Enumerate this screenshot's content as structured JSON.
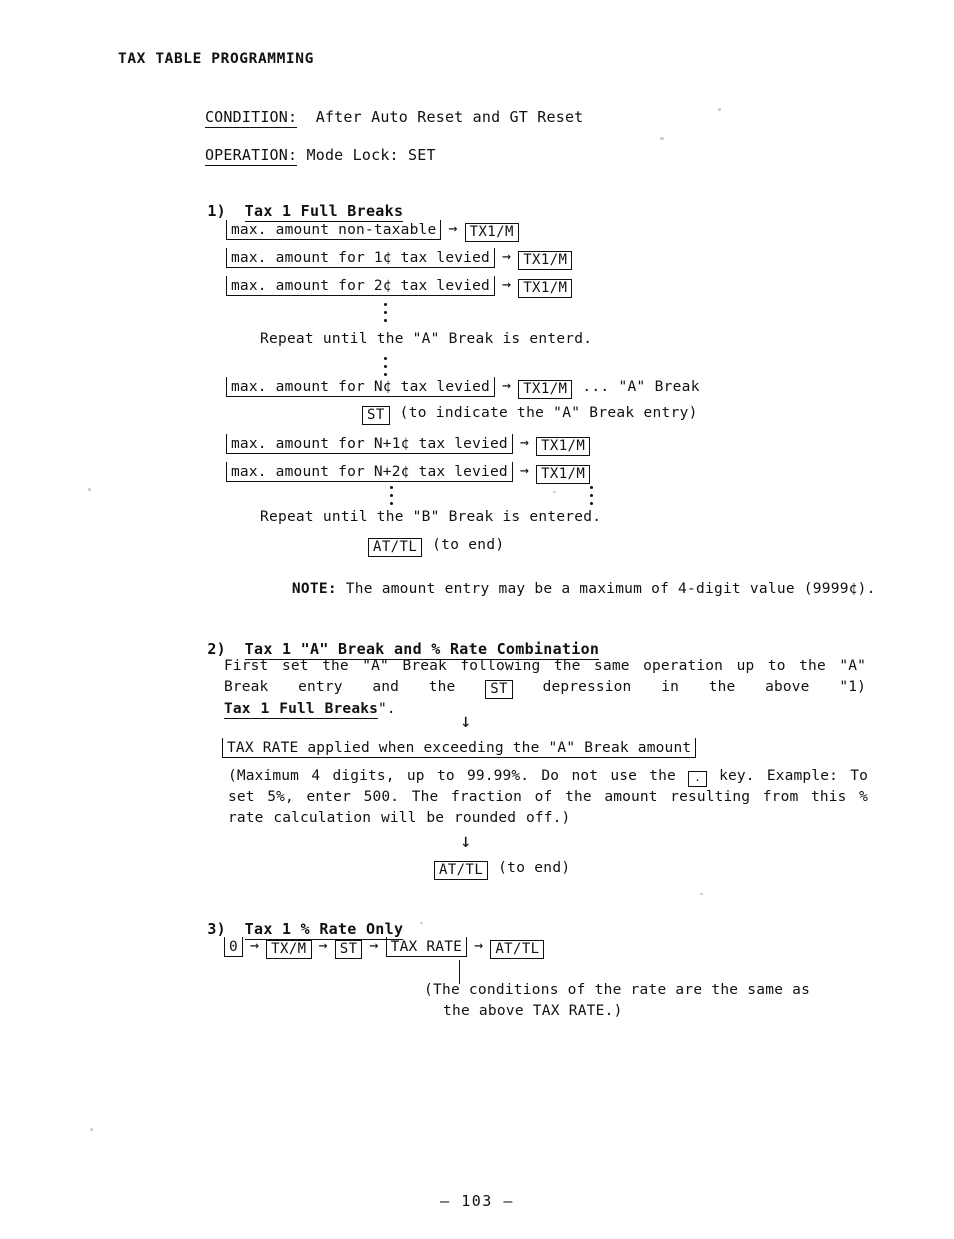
{
  "document": {
    "title": "TAX TABLE PROGRAMMING",
    "page_number": "– 103 –"
  },
  "preamble": {
    "condition_label": "CONDITION:",
    "condition_value": "  After Auto Reset and GT Reset",
    "operation_label": "OPERATION:",
    "operation_value": " Mode Lock: SET"
  },
  "section1": {
    "number": "1)",
    "heading": "Tax 1 Full Breaks",
    "rows": [
      {
        "field": "max. amount non-taxable",
        "arrow": "→",
        "key": "TX1/M",
        "tail": ""
      },
      {
        "field": "max. amount for 1¢ tax levied",
        "arrow": "→",
        "key": "TX1/M",
        "tail": ""
      },
      {
        "field": "max. amount for 2¢ tax levied",
        "arrow": "→",
        "key": "TX1/M",
        "tail": ""
      }
    ],
    "repeat_a": "Repeat until the \"A\" Break is enterd.",
    "break_a_row": {
      "field": "max. amount for N¢ tax levied",
      "arrow": "→",
      "key": "TX1/M",
      "tail": "... \"A\" Break"
    },
    "st_row": {
      "key": "ST",
      "note": "(to indicate the \"A\" Break entry)"
    },
    "rows_after": [
      {
        "field": "max. amount for N+1¢ tax levied",
        "arrow": "→",
        "key": "TX1/M",
        "tail": ""
      },
      {
        "field": "max. amount for N+2¢ tax levied",
        "arrow": "→",
        "key": "TX1/M",
        "tail": ""
      }
    ],
    "repeat_b": "Repeat until the \"B\" Break is entered.",
    "end_row": {
      "key": "AT/TL",
      "note": "(to end)"
    },
    "note_label": "NOTE:",
    "note_text": " The amount entry may be a maximum of 4-digit value (9999¢)."
  },
  "section2": {
    "number": "2)",
    "heading": "Tax 1 \"A\" Break and % Rate Combination",
    "para_part1": "First set the \"A\" Break following the same operation up to the \"A\" Break entry and the ",
    "para_key": "ST",
    "para_part2": " depression in the above \"1) ",
    "para_bold": "Tax 1 Full Breaks",
    "para_part3": "\".",
    "arrow_down": "↓",
    "rate_field": "TAX RATE applied when exceeding the \"A\" Break amount",
    "paren_part1": "(Maximum 4 digits, up to 99.99%.  Do not use the ",
    "paren_key": ".",
    "paren_part2": " key.  Example: To set 5%, enter 500.  The fraction of the amount resulting from this % rate calculation will be rounded off.)",
    "end_row": {
      "key": "AT/TL",
      "note": "(to end)"
    }
  },
  "section3": {
    "number": "3)",
    "heading": "Tax 1 % Rate Only",
    "flow": {
      "zero_field": "0",
      "arrow": "→",
      "key1": "TX/M",
      "key2": "ST",
      "rate_field": "TAX RATE",
      "key3": "AT/TL"
    },
    "footnote_line1": "(The conditions of the rate are the same as",
    "footnote_line2": "the above TAX RATE.)"
  }
}
